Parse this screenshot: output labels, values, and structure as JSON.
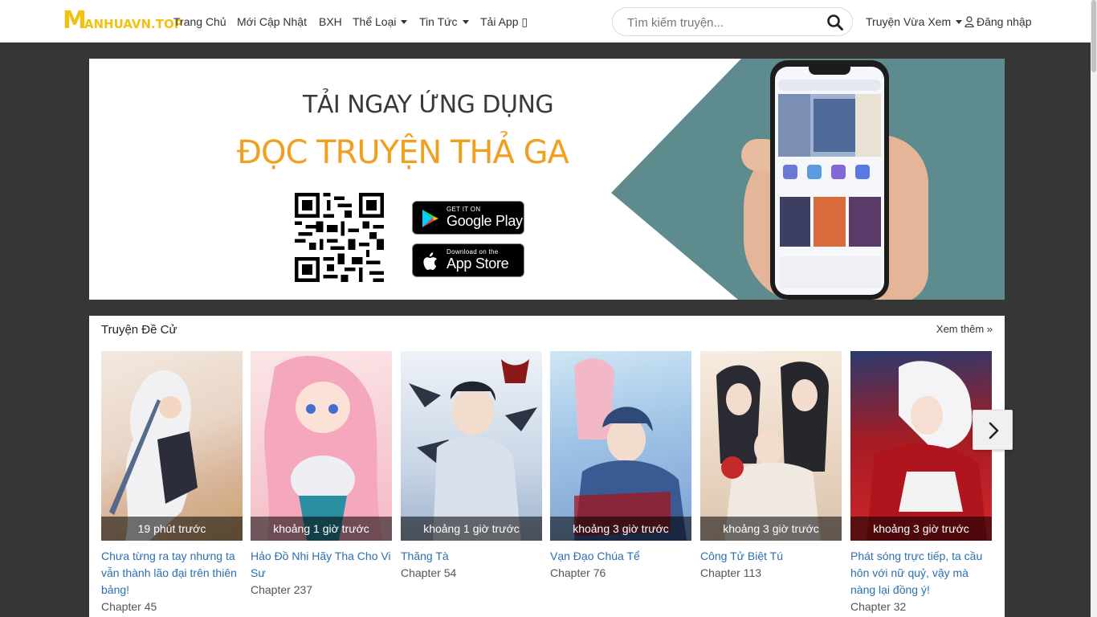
{
  "brand": {
    "logo_big": "M",
    "logo_rest": "ANHUAVN.TOP"
  },
  "nav": {
    "items": [
      {
        "label": "Trang Chủ"
      },
      {
        "label": "Mới Cập Nhật"
      },
      {
        "label": "BXH"
      },
      {
        "label": "Thể Loại"
      },
      {
        "label": "Tin Tức"
      },
      {
        "label": "Tải App ▯"
      }
    ]
  },
  "search": {
    "placeholder": "Tìm kiếm truyện..."
  },
  "header_right": {
    "history": "Truyện Vừa Xem",
    "login": "Đăng nhập"
  },
  "banner": {
    "headline1": "TẢI NGAY ỨNG DỤNG",
    "headline2": "ĐỌC TRUYỆN THẢ GA",
    "google_small": "GET IT ON",
    "google_name": "Google Play",
    "apple_small": "Download on the",
    "apple_name": "App Store"
  },
  "recommend": {
    "title": "Truyện Đề Cử",
    "more": "Xem thêm »",
    "cards": [
      {
        "title": "Chưa từng ra tay nhưng ta vẫn thành lão đại trên thiên bảng!",
        "chapter": "Chapter 45",
        "time": "19 phút trước"
      },
      {
        "title": "Hảo Đồ Nhi Hãy Tha Cho Vi Sư",
        "chapter": "Chapter 237",
        "time": "khoảng 1 giờ trước"
      },
      {
        "title": "Thăng Tà",
        "chapter": "Chapter 54",
        "time": "khoảng 1 giờ trước"
      },
      {
        "title": "Vạn Đạo Chúa Tể",
        "chapter": "Chapter 76",
        "time": "khoảng 3 giờ trước"
      },
      {
        "title": "Công Tử Biệt Tú",
        "chapter": "Chapter 113",
        "time": "khoảng 3 giờ trước"
      },
      {
        "title": "Phát sóng trực tiếp, ta cầu hôn với nữ quỷ, vậy mà nàng lại đồng ý!",
        "chapter": "Chapter 32",
        "time": "khoảng 3 giờ trước"
      }
    ]
  }
}
